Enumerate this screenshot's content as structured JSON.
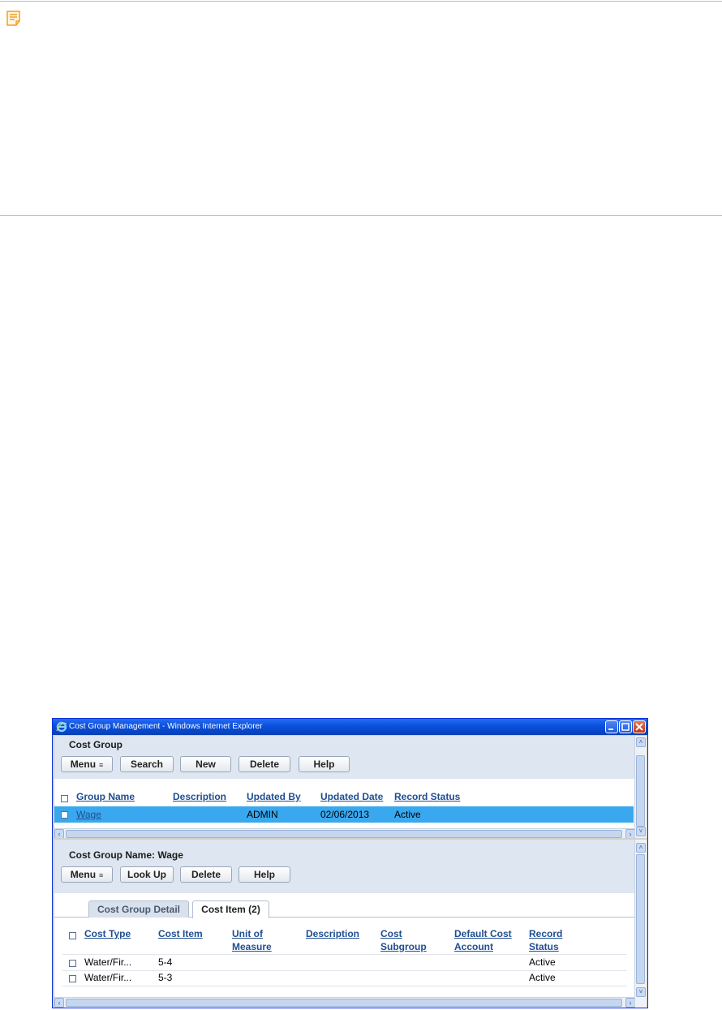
{
  "window": {
    "title": "Cost Group Management - Windows Internet Explorer",
    "buttons": [
      "minimize-icon",
      "maximize-icon",
      "close-icon"
    ]
  },
  "cost_group": {
    "title": "Cost Group",
    "toolbar": {
      "menu_label": "Menu",
      "search_label": "Search",
      "new_label": "New",
      "delete_label": "Delete",
      "help_label": "Help"
    },
    "columns": [
      "Group Name",
      "Description",
      "Updated By",
      "Updated Date",
      "Record Status"
    ],
    "rows": [
      {
        "group_name": "Wage",
        "description": "",
        "updated_by": "ADMIN",
        "updated_date": "02/06/2013",
        "record_status": "Active",
        "selected": true
      }
    ]
  },
  "detail": {
    "title": "Cost Group Name: Wage",
    "toolbar": {
      "menu_label": "Menu",
      "lookup_label": "Look Up",
      "delete_label": "Delete",
      "help_label": "Help"
    },
    "tabs": [
      "Cost Group Detail",
      "Cost Item (2)"
    ],
    "active_tab": 1,
    "columns": [
      {
        "line1": "Cost Type",
        "line2": ""
      },
      {
        "line1": "Cost Item",
        "line2": ""
      },
      {
        "line1": "Unit of",
        "line2": "Measure"
      },
      {
        "line1": "Description",
        "line2": ""
      },
      {
        "line1": "Cost",
        "line2": "Subgroup"
      },
      {
        "line1": "Default Cost",
        "line2": "Account"
      },
      {
        "line1": "Record",
        "line2": "Status"
      }
    ],
    "rows": [
      {
        "cost_type": "Water/Fir...",
        "cost_item": "5-4",
        "unit": "",
        "description": "",
        "subgroup": "",
        "account": "",
        "status": "Active"
      },
      {
        "cost_type": "Water/Fir...",
        "cost_item": "5-3",
        "unit": "",
        "description": "",
        "subgroup": "",
        "account": "",
        "status": "Active"
      }
    ]
  },
  "colors": {
    "selected_row": "#39a8ee",
    "link": "#1f4e91",
    "note_icon": "#f5a623",
    "title_bar": "#0a52e0"
  }
}
